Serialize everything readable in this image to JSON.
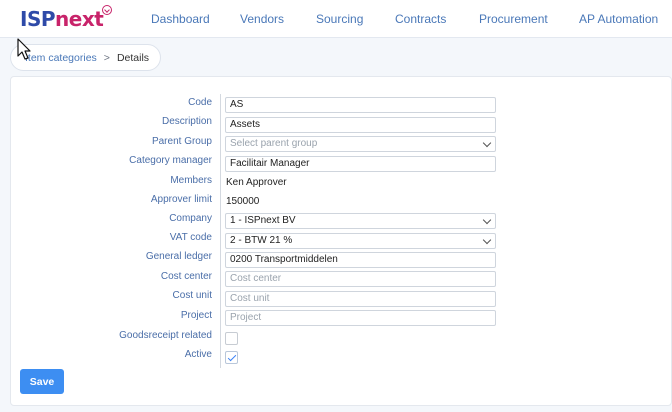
{
  "header": {
    "logo_isp": "ISP",
    "logo_next": "next",
    "nav": [
      "Dashboard",
      "Vendors",
      "Sourcing",
      "Contracts",
      "Procurement",
      "AP Automation"
    ]
  },
  "breadcrumb": {
    "link": "Item categories",
    "separator": ">",
    "current": "Details"
  },
  "form": {
    "code": {
      "label": "Code",
      "value": "AS"
    },
    "description": {
      "label": "Description",
      "value": "Assets"
    },
    "parent_group": {
      "label": "Parent Group",
      "placeholder": "Select parent group"
    },
    "category_manager": {
      "label": "Category manager",
      "value": "Facilitair Manager"
    },
    "members": {
      "label": "Members",
      "value": "Ken Approver"
    },
    "approver_limit": {
      "label": "Approver limit",
      "value": "150000"
    },
    "company": {
      "label": "Company",
      "value": "1 - ISPnext BV"
    },
    "vat_code": {
      "label": "VAT code",
      "value": "2 - BTW 21 %"
    },
    "general_ledger": {
      "label": "General ledger",
      "value": "0200 Transportmiddelen"
    },
    "cost_center": {
      "label": "Cost center",
      "placeholder": "Cost center"
    },
    "cost_unit": {
      "label": "Cost unit",
      "placeholder": "Cost unit"
    },
    "project": {
      "label": "Project",
      "placeholder": "Project"
    },
    "goodsreceipt_related": {
      "label": "Goodsreceipt related",
      "checked": false
    },
    "active": {
      "label": "Active",
      "checked": true
    }
  },
  "actions": {
    "save_label": "Save"
  },
  "colors": {
    "brand_blue": "#2e4aa8",
    "brand_pink": "#c8236a",
    "primary_button": "#3d8ef2",
    "link": "#4a78b8"
  }
}
